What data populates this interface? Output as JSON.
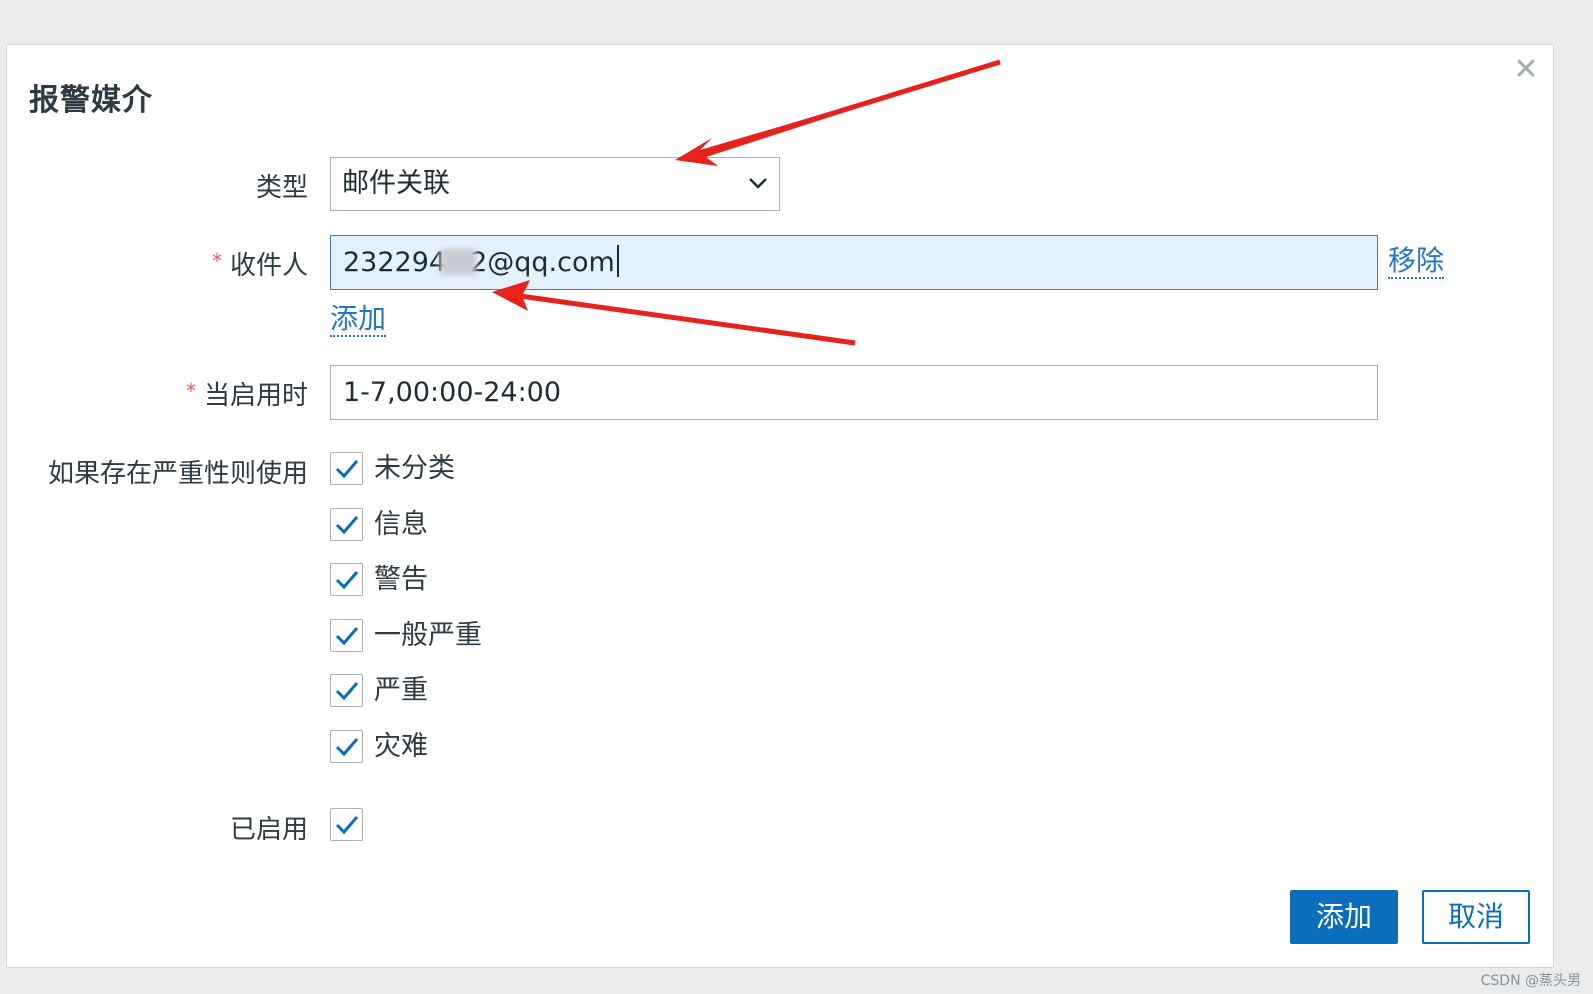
{
  "dialog": {
    "title": "报警媒介",
    "close_glyph": "✕"
  },
  "form": {
    "type_label": "类型",
    "type_value": "邮件关联",
    "recipient_label": "收件人",
    "recipient_value_prefix": "232294",
    "recipient_value_suffix": "2@qq.com",
    "remove_link": "移除",
    "add_link": "添加",
    "when_active_label": "当启用时",
    "when_active_value": "1-7,00:00-24:00",
    "severity_label": "如果存在严重性则使用",
    "severities": [
      {
        "label": "未分类",
        "checked": true
      },
      {
        "label": "信息",
        "checked": true
      },
      {
        "label": "警告",
        "checked": true
      },
      {
        "label": "一般严重",
        "checked": true
      },
      {
        "label": "严重",
        "checked": true
      },
      {
        "label": "灾难",
        "checked": true
      }
    ],
    "enabled_label": "已启用",
    "enabled_checked": true,
    "required_mark": "*"
  },
  "footer": {
    "add_button": "添加",
    "cancel_button": "取消"
  },
  "watermark": "CSDN @蒸头男",
  "colors": {
    "accent": "#0a6ebd",
    "link": "#2278c2",
    "required": "#e45959",
    "annotation_arrow": "#e8211d",
    "focused_field_bg": "#e4f1fd"
  },
  "icons": {
    "close": "close-icon",
    "dropdown": "chevron-down-icon",
    "checkbox": "checkmark-icon",
    "annotation": "red-arrow"
  }
}
